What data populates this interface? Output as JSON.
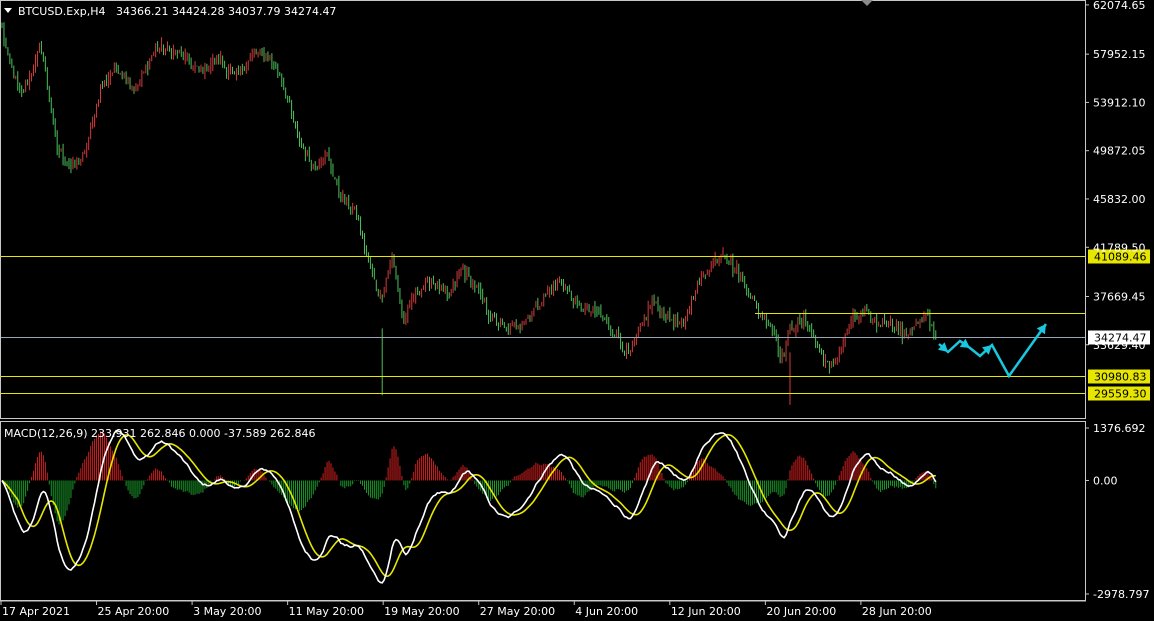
{
  "chart_data": {
    "type": "candlestick",
    "header": {
      "symbol": "BTCUSD.Exp,H4",
      "ohlc": "34366.21 34424.28 34037.79 34274.47"
    },
    "price_axis": {
      "min": 27500,
      "max": 62400,
      "ticks": [
        "62074.65",
        "57952.15",
        "53912.10",
        "49872.05",
        "45832.00",
        "41789.50",
        "37669.45",
        "33629.40"
      ],
      "tick_values": [
        62074.65,
        57952.15,
        53912.1,
        49872.05,
        45832.0,
        41789.5,
        37669.45,
        33629.4
      ]
    },
    "levels": [
      {
        "value": 41089.46,
        "label": "41089.46",
        "color": "#e6e600",
        "badge": true
      },
      {
        "value": 36300,
        "label": "",
        "color": "#e6e600",
        "badge": false
      },
      {
        "value": 30980.83,
        "label": "30980.83",
        "color": "#e6e600",
        "badge": true
      },
      {
        "value": 29559.3,
        "label": "29559.30",
        "color": "#e6e600",
        "badge": true
      }
    ],
    "current_price": {
      "value": 34274.47,
      "label": "34274.47"
    },
    "close_series_anchors": [
      [
        0,
        60000
      ],
      [
        3,
        57500
      ],
      [
        10,
        54500
      ],
      [
        20,
        58500
      ],
      [
        28,
        50000
      ],
      [
        35,
        48500
      ],
      [
        42,
        49500
      ],
      [
        50,
        55000
      ],
      [
        58,
        57000
      ],
      [
        68,
        55000
      ],
      [
        78,
        58500
      ],
      [
        90,
        58000
      ],
      [
        100,
        56500
      ],
      [
        110,
        57500
      ],
      [
        118,
        56000
      ],
      [
        128,
        58000
      ],
      [
        135,
        57800
      ],
      [
        142,
        56000
      ],
      [
        150,
        51000
      ],
      [
        158,
        48500
      ],
      [
        165,
        49500
      ],
      [
        172,
        46000
      ],
      [
        180,
        44500
      ],
      [
        186,
        40500
      ],
      [
        192,
        37500
      ],
      [
        198,
        41000
      ],
      [
        204,
        35500
      ],
      [
        210,
        38000
      ],
      [
        218,
        39000
      ],
      [
        226,
        37500
      ],
      [
        234,
        40000
      ],
      [
        240,
        38500
      ],
      [
        248,
        36000
      ],
      [
        256,
        34800
      ],
      [
        266,
        35800
      ],
      [
        276,
        37800
      ],
      [
        284,
        39000
      ],
      [
        292,
        36800
      ],
      [
        302,
        36300
      ],
      [
        312,
        34500
      ],
      [
        318,
        32600
      ],
      [
        324,
        35000
      ],
      [
        330,
        37200
      ],
      [
        338,
        36000
      ],
      [
        346,
        35200
      ],
      [
        352,
        38400
      ],
      [
        360,
        40400
      ],
      [
        366,
        41500
      ],
      [
        372,
        40000
      ],
      [
        378,
        38500
      ],
      [
        384,
        36300
      ],
      [
        390,
        35500
      ],
      [
        396,
        32500
      ],
      [
        400,
        35000
      ],
      [
        408,
        35800
      ],
      [
        414,
        33500
      ],
      [
        420,
        31500
      ],
      [
        426,
        33500
      ],
      [
        432,
        35800
      ],
      [
        438,
        36300
      ],
      [
        444,
        35300
      ],
      [
        450,
        35700
      ],
      [
        458,
        34400
      ],
      [
        464,
        35400
      ],
      [
        470,
        35900
      ],
      [
        474,
        34274
      ]
    ],
    "candle_count": 475,
    "forecast_path": [
      [
        939,
        344
      ],
      [
        948,
        352
      ],
      [
        960,
        341
      ],
      [
        970,
        348
      ],
      [
        980,
        356
      ],
      [
        992,
        345
      ],
      [
        1009,
        376
      ],
      [
        1046,
        324
      ]
    ],
    "forecast_color": "#18c7e0",
    "x_axis": {
      "labels": [
        "17 Apr 2021",
        "25 Apr 20:00",
        "3 May 20:00",
        "11 May 20:00",
        "19 May 20:00",
        "27 May 20:00",
        "4 Jun 20:00",
        "12 Jun 20:00",
        "20 Jun 20:00",
        "28 Jun 20:00"
      ]
    },
    "macd": {
      "title": "MACD(12,26,9) 233.931 262.846 0.000 -37.589 262.846",
      "min": -2978.797,
      "max": 1376.692,
      "ticks": [
        "1376.692",
        "0.00",
        "-2978.797"
      ],
      "tick_values": [
        1376.692,
        0,
        -2978.797
      ],
      "signal_color": "#e6e600",
      "macd_color": "#ffffff",
      "hist_up_color": "#d21f1f",
      "hist_down_color": "#1a9b2a"
    },
    "colors": {
      "bull": "#d23b3b",
      "bear": "#4cc25a",
      "grid_frame": "#c8c8c8",
      "background": "#000000"
    }
  }
}
